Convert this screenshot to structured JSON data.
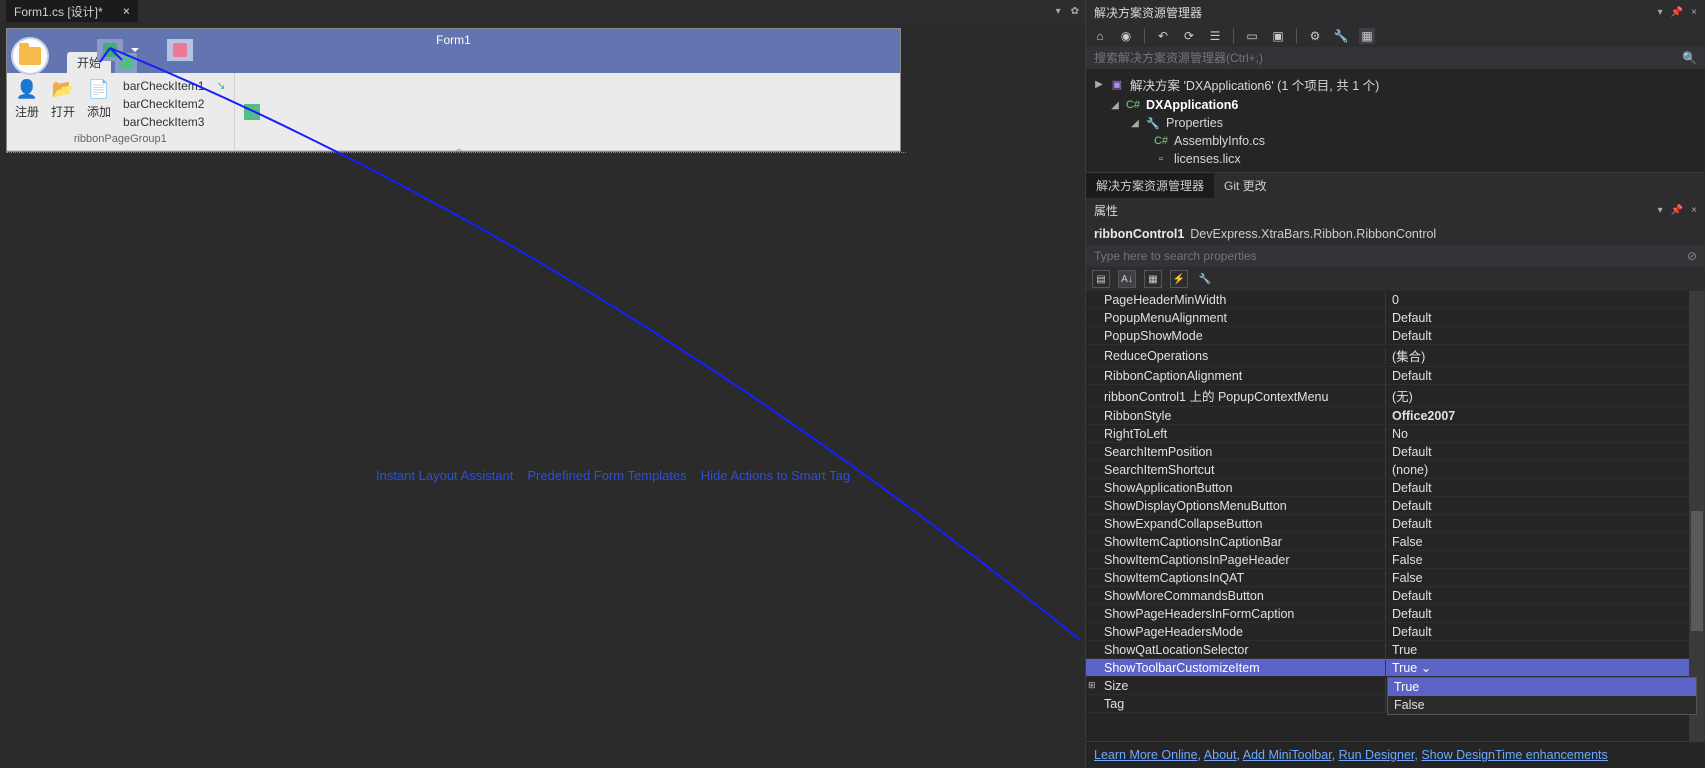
{
  "tab": {
    "title": "Form1.cs [设计]*",
    "close": "×"
  },
  "designer": {
    "form_title": "Form1",
    "ribbon_tab_start": "开始",
    "buttons": {
      "register": "注册",
      "open": "打开",
      "add": "添加"
    },
    "checkitems": [
      "barCheckItem1",
      "barCheckItem2",
      "barCheckItem3"
    ],
    "group_caption": "ribbonPageGroup1",
    "assistant": {
      "layout": "Instant Layout Assistant",
      "templates": "Predefined Form Templates",
      "hide": "Hide Actions to Smart Tag"
    }
  },
  "solution": {
    "panel_title": "解决方案资源管理器",
    "search_placeholder": "搜索解决方案资源管理器(Ctrl+;)",
    "root": "解决方案 'DXApplication6' (1 个项目, 共 1 个)",
    "project": "DXApplication6",
    "properties": "Properties",
    "files": [
      "AssemblyInfo.cs",
      "licenses.licx"
    ],
    "tabs": {
      "sol": "解决方案资源管理器",
      "git": "Git 更改"
    }
  },
  "props": {
    "panel_title": "属性",
    "object_name": "ribbonControl1",
    "object_class": "DevExpress.XtraBars.Ribbon.RibbonControl",
    "search_placeholder": "Type here to search properties",
    "rows": [
      {
        "name": "PageHeaderMinWidth",
        "value": "0"
      },
      {
        "name": "PopupMenuAlignment",
        "value": "Default"
      },
      {
        "name": "PopupShowMode",
        "value": "Default"
      },
      {
        "name": "ReduceOperations",
        "value": "(集合)"
      },
      {
        "name": "RibbonCaptionAlignment",
        "value": "Default"
      },
      {
        "name": "ribbonControl1 上的 PopupContextMenu",
        "value": "(无)"
      },
      {
        "name": "RibbonStyle",
        "value": "Office2007",
        "bold": true
      },
      {
        "name": "RightToLeft",
        "value": "No"
      },
      {
        "name": "SearchItemPosition",
        "value": "Default"
      },
      {
        "name": "SearchItemShortcut",
        "value": "(none)"
      },
      {
        "name": "ShowApplicationButton",
        "value": "Default"
      },
      {
        "name": "ShowDisplayOptionsMenuButton",
        "value": "Default"
      },
      {
        "name": "ShowExpandCollapseButton",
        "value": "Default"
      },
      {
        "name": "ShowItemCaptionsInCaptionBar",
        "value": "False"
      },
      {
        "name": "ShowItemCaptionsInPageHeader",
        "value": "False"
      },
      {
        "name": "ShowItemCaptionsInQAT",
        "value": "False"
      },
      {
        "name": "ShowMoreCommandsButton",
        "value": "Default"
      },
      {
        "name": "ShowPageHeadersInFormCaption",
        "value": "Default"
      },
      {
        "name": "ShowPageHeadersMode",
        "value": "Default"
      },
      {
        "name": "ShowQatLocationSelector",
        "value": "True"
      },
      {
        "name": "ShowToolbarCustomizeItem",
        "value": "True",
        "selected": true
      },
      {
        "name": "Size",
        "value": "",
        "expand": true
      },
      {
        "name": "Tag",
        "value": ""
      }
    ],
    "dropdown": {
      "options": [
        "True",
        "False"
      ],
      "selected": "True"
    },
    "footer": {
      "learn": "Learn More Online",
      "about": "About",
      "addmini": "Add MiniToolbar",
      "rundesigner": "Run Designer",
      "showdt": "Show DesignTime enhancements"
    }
  }
}
